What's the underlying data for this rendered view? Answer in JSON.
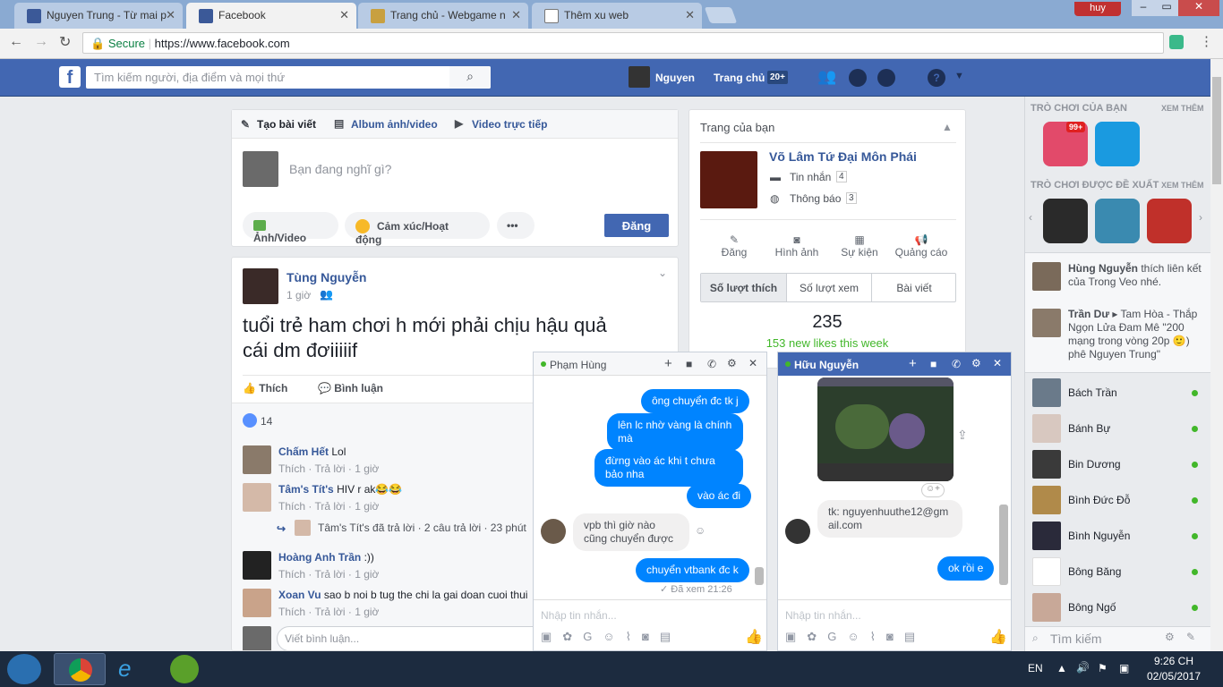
{
  "browser": {
    "tabs": [
      {
        "title": "Nguyen Trung - Từ mai p"
      },
      {
        "title": "Facebook"
      },
      {
        "title": "Trang chủ - Webgame n"
      },
      {
        "title": "Thêm xu web"
      }
    ],
    "user_label": "huy",
    "secure_label": "Secure",
    "url": "https://www.facebook.com"
  },
  "fb_header": {
    "search_placeholder": "Tìm kiếm người, địa điểm và mọi thứ",
    "profile_name": "Nguyen",
    "home_label": "Trang chủ",
    "home_badge": "20+"
  },
  "composer": {
    "tab_post": "Tạo bài viết",
    "tab_album": "Album ảnh/video",
    "tab_live": "Video trực tiếp",
    "placeholder": "Bạn đang nghĩ gì?",
    "photo": "Ảnh/Video",
    "feeling": "Cảm xúc/Hoạt động",
    "more": "•••",
    "post_button": "Đăng"
  },
  "post": {
    "author": "Tùng Nguyễn",
    "time": "1 giờ",
    "text_line1": "tuổi trẻ ham chơi h mới phải chịu hậu quả",
    "text_line2": "cái dm đơiiiiif",
    "like": "Thích",
    "comment": "Bình luận",
    "likes": "14",
    "comments": [
      {
        "name": "Chấm Hết",
        "text": "Lol",
        "actions": "Thích · Trả lời · 1 giờ"
      },
      {
        "name": "Tâm's Tít's",
        "text": "HIV r ak😂😂",
        "actions": "Thích · Trả lời · 1 giờ"
      },
      {
        "name": "Hoàng Anh Trần",
        "text": ":))",
        "actions": "Thích · Trả lời · 1 giờ"
      },
      {
        "name": "Xoan Vu",
        "text": "sao b noi b tug the chi la gai doan cuoi thui",
        "actions": "Thích · Trả lời · 1 giờ"
      }
    ],
    "reply_note": "Tâm's Tít's đã trả lời · 2 câu trả lời · 23 phút",
    "write_comment": "Viết bình luận..."
  },
  "pages": {
    "title": "Trang của bạn",
    "page_name": "Võ Lâm Tứ Đại Môn Phái",
    "messages": "Tin nhắn",
    "messages_count": "4",
    "notifications": "Thông báo",
    "notifications_count": "3",
    "actions": [
      "Đăng",
      "Hình ảnh",
      "Sự kiện",
      "Quảng cáo"
    ],
    "tabs": [
      "Số lượt thích",
      "Số lượt xem",
      "Bài viết"
    ],
    "likes": "235",
    "new_likes": "153 new likes this week"
  },
  "chat1": {
    "name": "Phạm Hùng",
    "messages": [
      "ông chuyển đc tk j",
      "lên lc nhờ vàng là chính mà",
      "đừng vào ác khi t chưa bảo nha",
      "vào ác đi",
      "vpb thì giờ nào cũng chuyển được",
      "chuyển vtbank đc k"
    ],
    "seen": "✓ Đã xem 21:26",
    "input_placeholder": "Nhập tin nhắn..."
  },
  "chat2": {
    "name": "Hữu Nguyễn",
    "messages": [
      "tk: nguyenhuuthe12@gmail.com",
      "ok rồi e"
    ],
    "input_placeholder": "Nhập tin nhắn..."
  },
  "sidebar": {
    "games_title": "TRÒ CHƠI CỦA BẠN",
    "see_more": "XEM THÊM",
    "game_badge": "99+",
    "suggested_title": "TRÒ CHƠI ĐƯỢC ĐỀ XUẤT",
    "see_more2": "XEM THÊM",
    "ticker": [
      {
        "name": "Hùng Nguyễn",
        "text": "thích liên kết của Trong Veo nhé."
      },
      {
        "name": "Trần Dư",
        "text": "▸ Tam Hòa - Thắp Ngọn Lửa Đam Mê \"200 mạng trong vòng 20p 🙂) phê Nguyen Trung\""
      }
    ],
    "friends": [
      "Bách Trần",
      "Bánh Bự",
      "Bin Dương",
      "Bình Đức Đỗ",
      "Bình Nguyễn",
      "Bông Băng",
      "Bông Ngố"
    ],
    "search_label": "Tìm kiếm"
  },
  "taskbar": {
    "lang": "EN",
    "time": "9:26 CH",
    "date": "02/05/2017"
  },
  "colors": {
    "fb_blue": "#4267b2",
    "link": "#365899",
    "online": "#42b72a"
  }
}
